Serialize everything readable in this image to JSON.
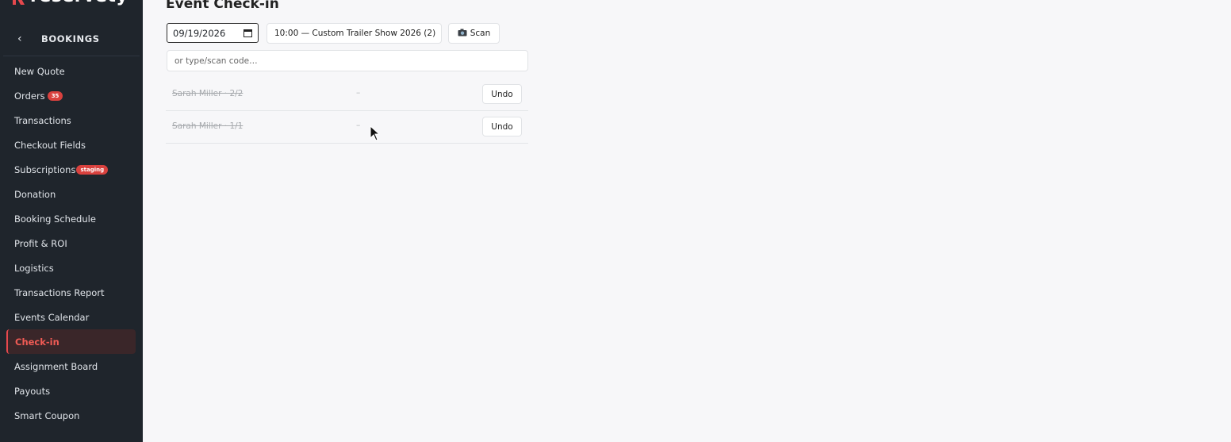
{
  "brand": {
    "name": "reservety"
  },
  "sidebar": {
    "section_title": "BOOKINGS",
    "back_label": "‹",
    "items": [
      {
        "label": "New Quote"
      },
      {
        "label": "Orders",
        "badge": "35"
      },
      {
        "label": "Transactions"
      },
      {
        "label": "Checkout Fields"
      },
      {
        "label": "Subscriptions",
        "badge": "staging"
      },
      {
        "label": "Donation"
      },
      {
        "label": "Booking Schedule"
      },
      {
        "label": "Profit & ROI"
      },
      {
        "label": "Logistics"
      },
      {
        "label": "Transactions Report"
      },
      {
        "label": "Events Calendar"
      },
      {
        "label": "Check-in",
        "active": true
      },
      {
        "label": "Assignment Board"
      },
      {
        "label": "Payouts"
      },
      {
        "label": "Smart Coupon"
      }
    ]
  },
  "main": {
    "title": "Event Check-in",
    "date_value": "09/19/2026",
    "session_value": "10:00 — Custom Trailer Show 2026 (2)",
    "scan_label": "Scan",
    "code_placeholder": "or type/scan code…",
    "rows": [
      {
        "name": "Sarah Miller · 2/2",
        "info": "–",
        "action": "Undo"
      },
      {
        "name": "Sarah Miller · 1/1",
        "info": "–",
        "action": "Undo"
      }
    ]
  },
  "colors": {
    "sidebar_bg": "#1f252c",
    "accent": "#e5484d",
    "badge": "#d9413e",
    "page_bg": "#f7f7f9"
  }
}
